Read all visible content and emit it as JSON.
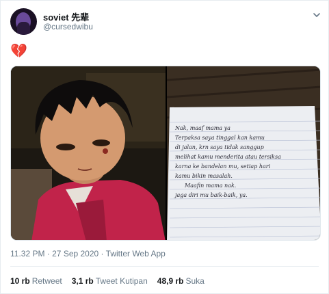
{
  "author": {
    "display_name": "soviet 先辈",
    "handle": "@cursedwibu"
  },
  "tweet": {
    "text": "💔"
  },
  "note": {
    "lines": [
      "Nak, maaf mama ya",
      "Terpaksa saya tinggal kan kamu",
      "di jalan, krn saya tidak sanggup",
      "melihat kamu menderita atau tersiksa",
      "karna ke bandelan mu, setiap hari",
      "kamu bikin masalah.",
      "Maafin mama nak.",
      "jaga diri mu baik-baik, ya."
    ]
  },
  "meta": {
    "timestamp": "11.32 PM · 27 Sep 2020 · Twitter Web App"
  },
  "stats": [
    {
      "value": "10 rb",
      "label": "Retweet"
    },
    {
      "value": "3,1 rb",
      "label": "Tweet Kutipan"
    },
    {
      "value": "48,9 rb",
      "label": "Suka"
    }
  ],
  "colors": {
    "secondary_text": "#657786",
    "primary_text": "#14171a",
    "border": "#e6ecf0"
  }
}
